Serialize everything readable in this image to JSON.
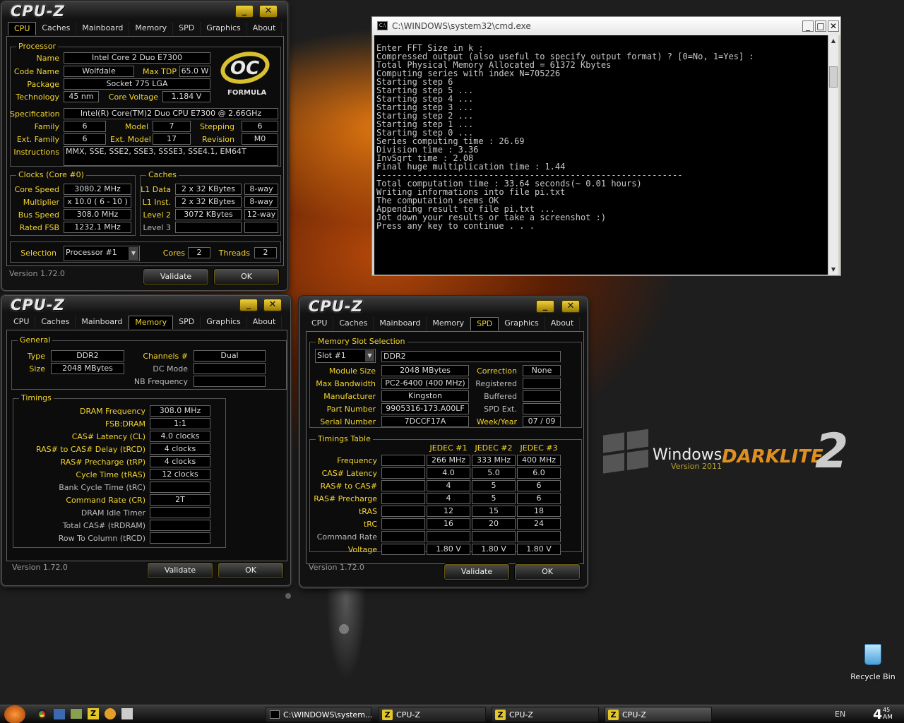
{
  "cmd": {
    "title": "C:\\WINDOWS\\system32\\cmd.exe",
    "lines": [
      "Enter FFT Size in k :",
      "Compressed output (also useful to specify output format) ? [0=No, 1=Yes] :",
      "Total Physical Memory Allocated = 61372 Kbytes",
      "Computing series with index N=705226",
      "Starting step 6",
      "Starting step 5 ...",
      "Starting step 4 ...",
      "Starting step 3 ...",
      "Starting step 2 ...",
      "Starting step 1 ...",
      "Starting step 0 ...",
      "Series computing time : 26.69",
      "Division time : 3.36",
      "InvSqrt time : 2.08",
      "Final huge multiplication time : 1.44",
      "------------------------------------------------------------",
      "Total computation time : 33.64 seconds(~ 0.01 hours)",
      "Writing informations into file pi.txt",
      "",
      "The computation seems OK",
      "Appending result to file pi.txt ...",
      "",
      "Jot down your results or take a screenshot :)",
      "Press any key to continue . . ."
    ]
  },
  "cpuz": {
    "title": "CPU-Z",
    "tabs": [
      "CPU",
      "Caches",
      "Mainboard",
      "Memory",
      "SPD",
      "Graphics",
      "About"
    ],
    "version": "Version 1.72.0",
    "validate": "Validate",
    "ok": "OK",
    "min": "_",
    "close": "✕"
  },
  "w1": {
    "processor": "Processor",
    "name_l": "Name",
    "name": "Intel Core 2 Duo E7300",
    "codename_l": "Code Name",
    "codename": "Wolfdale",
    "maxtdp_l": "Max TDP",
    "maxtdp": "65.0 W",
    "package_l": "Package",
    "package": "Socket 775 LGA",
    "tech_l": "Technology",
    "tech": "45 nm",
    "cvolt_l": "Core Voltage",
    "cvolt": "1.184 V",
    "spec_l": "Specification",
    "spec": "Intel(R) Core(TM)2 Duo CPU     E7300  @ 2.66GHz",
    "family_l": "Family",
    "family": "6",
    "model_l": "Model",
    "model": "7",
    "stepping_l": "Stepping",
    "stepping": "6",
    "extfam_l": "Ext. Family",
    "extfam": "6",
    "extmod_l": "Ext. Model",
    "extmod": "17",
    "revision_l": "Revision",
    "revision": "M0",
    "instr_l": "Instructions",
    "instr": "MMX, SSE, SSE2, SSE3, SSSE3, SSE4.1, EM64T",
    "logo_text": "FORMULA",
    "clocks": "Clocks (Core #0)",
    "cspeed_l": "Core Speed",
    "cspeed": "3080.2 MHz",
    "mult_l": "Multiplier",
    "mult": "x 10.0 ( 6 - 10 )",
    "bus_l": "Bus Speed",
    "bus": "308.0 MHz",
    "fsb_l": "Rated FSB",
    "fsb": "1232.1 MHz",
    "caches": "Caches",
    "l1d_l": "L1 Data",
    "l1d": "2 x 32 KBytes",
    "l1d_w": "8-way",
    "l1i_l": "L1 Inst.",
    "l1i": "2 x 32 KBytes",
    "l1i_w": "8-way",
    "l2_l": "Level 2",
    "l2": "3072 KBytes",
    "l2_w": "12-way",
    "l3_l": "Level 3",
    "sel_l": "Selection",
    "sel": "Processor #1",
    "cores_l": "Cores",
    "cores": "2",
    "threads_l": "Threads",
    "threads": "2"
  },
  "w2": {
    "general": "General",
    "type_l": "Type",
    "type": "DDR2",
    "size_l": "Size",
    "size": "2048 MBytes",
    "ch_l": "Channels #",
    "ch": "Dual",
    "dc_l": "DC Mode",
    "nb_l": "NB Frequency",
    "timings": "Timings",
    "rows": [
      {
        "l": "DRAM Frequency",
        "v": "308.0 MHz",
        "y": true
      },
      {
        "l": "FSB:DRAM",
        "v": "1:1",
        "y": true
      },
      {
        "l": "CAS# Latency (CL)",
        "v": "4.0 clocks",
        "y": true
      },
      {
        "l": "RAS# to CAS# Delay (tRCD)",
        "v": "4 clocks",
        "y": true
      },
      {
        "l": "RAS# Precharge (tRP)",
        "v": "4 clocks",
        "y": true
      },
      {
        "l": "Cycle Time (tRAS)",
        "v": "12 clocks",
        "y": true
      },
      {
        "l": "Bank Cycle Time (tRC)",
        "v": "",
        "y": false
      },
      {
        "l": "Command Rate (CR)",
        "v": "2T",
        "y": true
      },
      {
        "l": "DRAM Idle Timer",
        "v": "",
        "y": false
      },
      {
        "l": "Total CAS# (tRDRAM)",
        "v": "",
        "y": false
      },
      {
        "l": "Row To Column (tRCD)",
        "v": "",
        "y": false
      }
    ]
  },
  "w3": {
    "slotsel": "Memory Slot Selection",
    "slot": "Slot #1",
    "slottype": "DDR2",
    "msize_l": "Module Size",
    "msize": "2048 MBytes",
    "maxbw_l": "Max Bandwidth",
    "maxbw": "PC2-6400 (400 MHz)",
    "manu_l": "Manufacturer",
    "manu": "Kingston",
    "part_l": "Part Number",
    "part": "9905316-173.A00LF",
    "serial_l": "Serial Number",
    "serial": "7DCCF17A",
    "corr_l": "Correction",
    "corr": "None",
    "reg_l": "Registered",
    "buf_l": "Buffered",
    "spdext_l": "SPD Ext.",
    "week_l": "Week/Year",
    "week": "07 / 09",
    "ttable": "Timings Table",
    "cols": [
      "JEDEC #1",
      "JEDEC #2",
      "JEDEC #3"
    ],
    "trows": [
      {
        "l": "Frequency",
        "v": [
          "266 MHz",
          "333 MHz",
          "400 MHz"
        ],
        "y": true
      },
      {
        "l": "CAS# Latency",
        "v": [
          "4.0",
          "5.0",
          "6.0"
        ],
        "y": true
      },
      {
        "l": "RAS# to CAS#",
        "v": [
          "4",
          "5",
          "6"
        ],
        "y": true
      },
      {
        "l": "RAS# Precharge",
        "v": [
          "4",
          "5",
          "6"
        ],
        "y": true
      },
      {
        "l": "tRAS",
        "v": [
          "12",
          "15",
          "18"
        ],
        "y": true
      },
      {
        "l": "tRC",
        "v": [
          "16",
          "20",
          "24"
        ],
        "y": true
      },
      {
        "l": "Command Rate",
        "v": [
          "",
          "",
          ""
        ],
        "y": false
      },
      {
        "l": "Voltage",
        "v": [
          "1.80 V",
          "1.80 V",
          "1.80 V"
        ],
        "y": true
      }
    ]
  },
  "desktop": {
    "brand1": "Windows",
    "brand2": "Version 2011",
    "brand3": "DARKLITE",
    "brand4": "2",
    "recycle": "Recycle Bin"
  },
  "taskbar": {
    "items": [
      "C:\\WINDOWS\\system...",
      "CPU-Z",
      "CPU-Z",
      "CPU-Z"
    ],
    "lang": "EN",
    "time_h": "4",
    "time_m": "45",
    "time_ampm": "AM"
  },
  "colors": {
    "accent": "#f4d52c",
    "bg": "#0c0c0c"
  }
}
